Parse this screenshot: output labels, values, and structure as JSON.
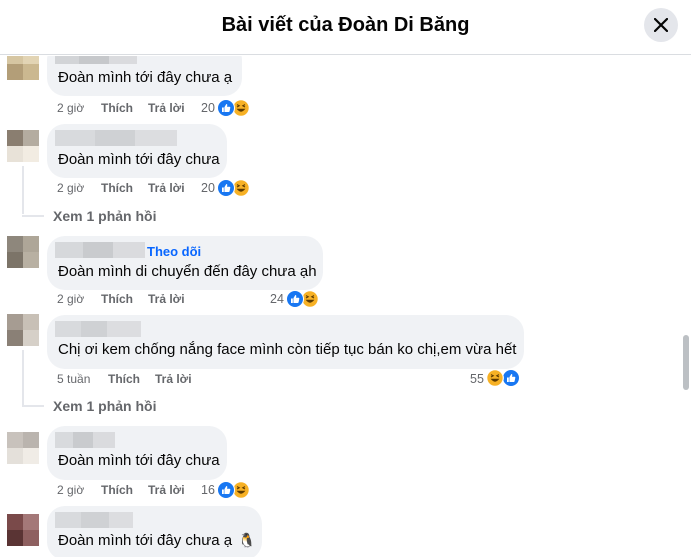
{
  "header": {
    "title": "Bài viết của Đoàn Di Băng"
  },
  "actions": {
    "like": "Thích",
    "reply": "Trả lời"
  },
  "comments": [
    {
      "text": "Đoàn mình tới đây chưa ạ",
      "time": "2 giờ",
      "reactions": "20"
    },
    {
      "text": "Đoàn mình tới đây chưa",
      "time": "2 giờ",
      "reactions": "20"
    },
    {
      "text": "Đoàn mình di chuyển đến đây chưa ạh",
      "time": "2 giờ",
      "reactions": "24",
      "follow": "Theo dõi"
    },
    {
      "text": "Chị ơi kem chống nắng face mình còn tiếp tục bán ko chị,em vừa hết",
      "time": "5 tuần",
      "reactions": "55"
    },
    {
      "text": "Đoàn mình tới đây chưa",
      "time": "2 giờ",
      "reactions": "16"
    },
    {
      "text": "Đoàn mình tới đây chưa ạ",
      "emoji": "🐧"
    }
  ],
  "view_replies": [
    "Xem 1 phản hồi",
    "Xem 1 phản hồi"
  ],
  "colors": {
    "link": "#0866ff",
    "bubble": "#f0f2f5",
    "like": "#1877f2",
    "haha": "#f7b125",
    "secondary": "#65676b"
  },
  "icons": {
    "close": "close-icon",
    "like": "like-reaction-icon",
    "haha": "haha-reaction-icon"
  }
}
